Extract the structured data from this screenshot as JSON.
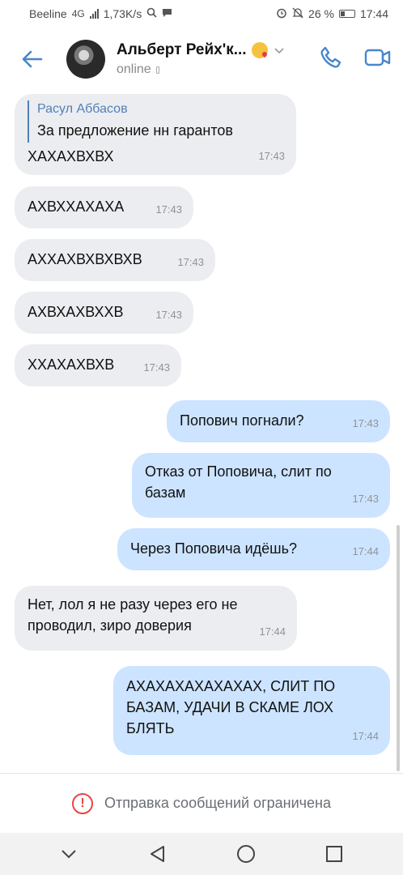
{
  "status_bar": {
    "carrier": "Beeline",
    "network": "4G",
    "speed": "1,73K/s",
    "battery": "26 %",
    "time": "17:44"
  },
  "header": {
    "name": "Альберт Рейх'к...",
    "status": "online",
    "back_icon": "arrow-left-icon",
    "call_icon": "phone-icon",
    "video_icon": "video-camera-icon"
  },
  "messages": [
    {
      "dir": "in",
      "reply_author": "Расул Аббасов",
      "reply_text": "За предложение нн гарантов",
      "text": "ХАХАХВХВХ",
      "time": "17:43"
    },
    {
      "dir": "in",
      "text": "АХВХХАХАХА",
      "time": "17:43"
    },
    {
      "dir": "in",
      "text": "АХХАХВХВХВХВ",
      "time": "17:43"
    },
    {
      "dir": "in",
      "text": "АХВХАХВХХВ",
      "time": "17:43"
    },
    {
      "dir": "in",
      "text": "ХХАХАХВХВ",
      "time": "17:43"
    },
    {
      "dir": "out",
      "text": "Попович погнали?",
      "time": "17:43"
    },
    {
      "dir": "out",
      "line1": "Отказ от Поповича, слит по",
      "line2": "базам",
      "time": "17:43"
    },
    {
      "dir": "out",
      "text": "Через Поповича идёшь?",
      "time": "17:44"
    },
    {
      "dir": "in",
      "line1": "Нет, лол я не разу через его не",
      "line2": "проводил, зиро доверия",
      "time": "17:44"
    },
    {
      "dir": "out",
      "line1": "АХАХАХАХАХАХАХ, СЛИТ ПО",
      "line2": "БАЗАМ, УДАЧИ В СКАМЕ ЛОХ",
      "line3": "БЛЯТЬ",
      "time": "17:44"
    }
  ],
  "restriction": {
    "text": "Отправка сообщений ограничена",
    "icon": "exclamation-circle-icon"
  },
  "colors": {
    "accent": "#5181b8",
    "incoming_bubble": "#ebedf0",
    "outgoing_bubble": "#cce4ff",
    "warning": "#e64646"
  }
}
